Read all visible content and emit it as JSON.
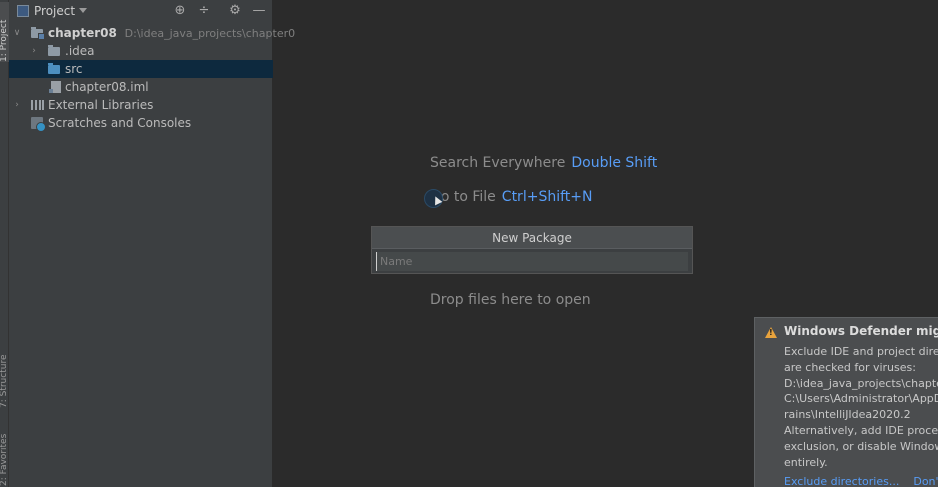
{
  "tool_stripe": {
    "project_tab": "1: Project",
    "structure_tab": "7: Structure",
    "favorites_tab": "2: Favorites"
  },
  "project_panel": {
    "title": "Project",
    "icons": [
      "locate-icon",
      "collapse-all-icon",
      "gear-icon",
      "minimize-icon"
    ],
    "tree": {
      "root_name": "chapter08",
      "root_path": "D:\\idea_java_projects\\chapter0",
      "idea_folder": ".idea",
      "src_folder": "src",
      "iml_file": "chapter08.iml",
      "external_libraries": "External Libraries",
      "scratches": "Scratches and Consoles"
    }
  },
  "editor": {
    "search_everywhere": "Search Everywhere",
    "search_everywhere_shortcut": "Double Shift",
    "go_to_file": "Go to File",
    "go_to_file_shortcut": "Ctrl+Shift+N",
    "drop_files": "Drop files here to open"
  },
  "new_package_popup": {
    "title": "New Package",
    "input_placeholder": "Name",
    "input_value": ""
  },
  "notification": {
    "title": "Windows Defender might i",
    "body_lines": [
      "Exclude IDE and project direc",
      "are checked for viruses:",
      "D:\\idea_java_projects\\chapte",
      "C:\\Users\\Administrator\\AppD",
      "rains\\IntelliJIdea2020.2",
      "Alternatively, add IDE proces",
      "exclusion, or disable Window",
      "entirely."
    ],
    "link_exclude": "Exclude directories...",
    "link_dont": "Don't",
    "warning_color": "#e8a33d"
  },
  "colors": {
    "accent_link": "#589df6",
    "selection": "#0d293e",
    "panel_bg": "#3c3f41",
    "editor_bg": "#2b2b2b"
  }
}
